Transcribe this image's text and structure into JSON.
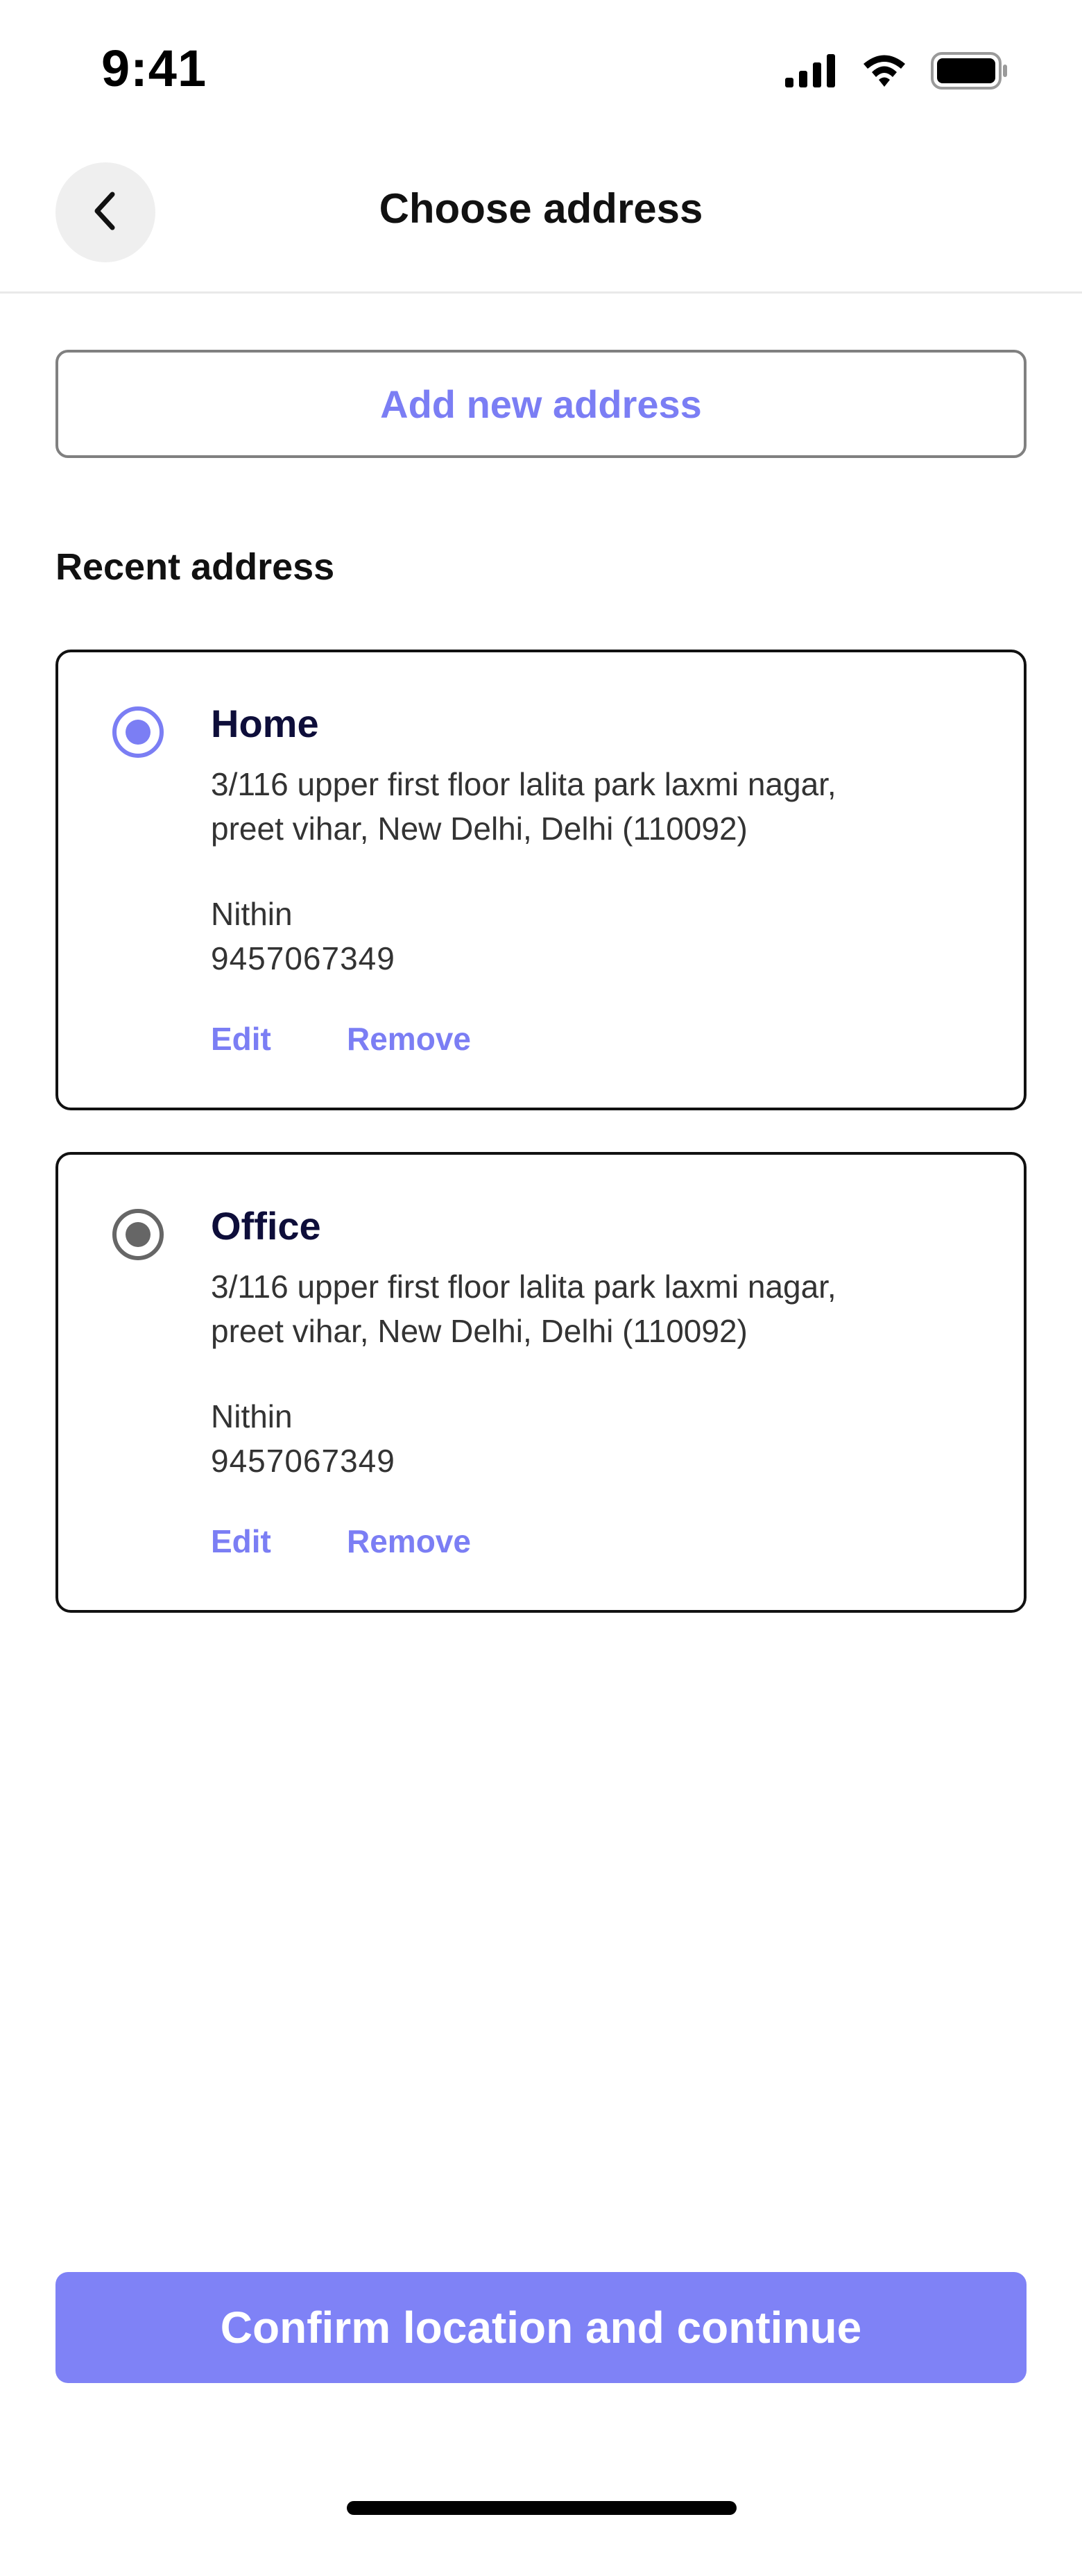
{
  "status_bar": {
    "time": "9:41",
    "icons": [
      "signal-icon",
      "wifi-icon",
      "battery-icon"
    ]
  },
  "header": {
    "title": "Choose address",
    "back_icon": "chevron-left-icon"
  },
  "add_address": {
    "label": "Add new address"
  },
  "recent": {
    "title": "Recent address",
    "addresses": [
      {
        "name": "Home",
        "address_line_1": "3/116 upper first floor lalita park laxmi nagar,",
        "address_line_2": "preet vihar, New Delhi, Delhi (110092)",
        "person": "Nithin",
        "phone": "9457067349",
        "edit_label": "Edit",
        "remove_label": "Remove",
        "selected": true
      },
      {
        "name": "Office",
        "address_line_1": "3/116 upper first floor lalita park laxmi nagar,",
        "address_line_2": "preet vihar, New Delhi, Delhi (110092)",
        "person": "Nithin",
        "phone": "9457067349",
        "edit_label": "Edit",
        "remove_label": "Remove",
        "selected": false
      }
    ]
  },
  "confirm": {
    "label": "Confirm location and continue"
  },
  "colors": {
    "accent": "#7b7ef4",
    "button_bg": "#7f82f6",
    "text_dark": "#0e0e3a"
  }
}
